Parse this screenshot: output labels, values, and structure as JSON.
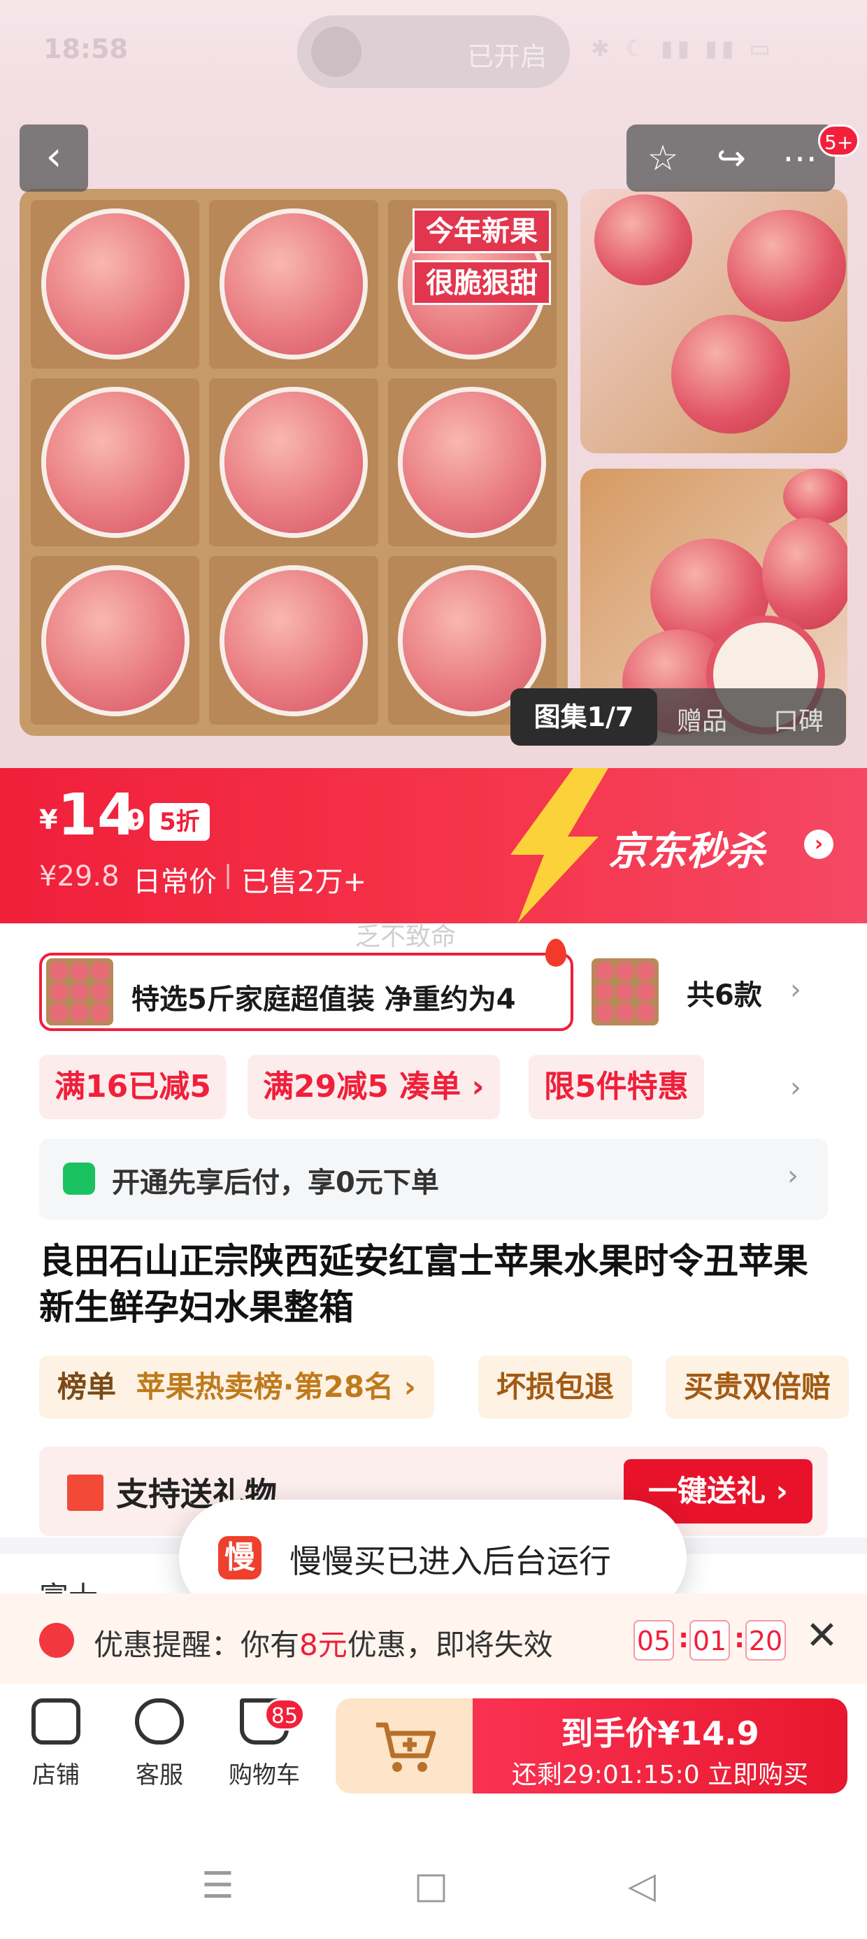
{
  "status_bar": {
    "time": "18:58",
    "voice_state": "已开启",
    "indicators": "✱ ☾ ▮▮ ▮▮ ▭"
  },
  "gallery": {
    "badge_count": "5+",
    "overlay_tags": [
      "今年新果",
      "很脆狠甜"
    ],
    "tabs": [
      {
        "label": "图集1/7",
        "active": true
      },
      {
        "label": "赠品"
      },
      {
        "label": "口碑"
      }
    ]
  },
  "price": {
    "currency": "¥",
    "integer": "14",
    "decimal": ".9",
    "discount": "5折",
    "original": "¥29.8",
    "original_label": "日常价",
    "separator": "|",
    "sold": "已售2万+",
    "promo": "京东秒杀",
    "promo_arrow": "›"
  },
  "watermark": "乏不致命",
  "variant": {
    "name": "特选5斤家庭超值装 净重约为4",
    "count": "共6款"
  },
  "coupons": [
    "满16已减5",
    "满29减5  凑单 ›",
    "限5件特惠"
  ],
  "pay_later": {
    "text": "开通先享后付，享0元下单"
  },
  "product_title": "良田石山正宗陕西延安红富士苹果水果时令丑苹果新生鲜孕妇水果整箱",
  "rank_chips": [
    {
      "label": "榜单",
      "detail": "苹果热卖榜·第28名 ›"
    },
    {
      "label": "坏损包退"
    },
    {
      "label": "买贵双倍赔"
    }
  ],
  "gift": {
    "text": "支持送礼物",
    "button": "一键送礼 ›"
  },
  "section_peek": "富士",
  "toast": {
    "icon": "慢",
    "text": "慢慢买已进入后台运行"
  },
  "reminder": {
    "prefix": "优惠提醒：你有",
    "amount": "8元",
    "suffix": "优惠，即将失效",
    "timer": [
      "05",
      "01",
      "20"
    ],
    "close": "✕"
  },
  "bottom_nav": {
    "items": [
      {
        "label": "店铺",
        "icon": "store-icon"
      },
      {
        "label": "客服",
        "icon": "service-icon"
      },
      {
        "label": "购物车",
        "icon": "cart-icon"
      }
    ],
    "cart_count": "85",
    "buy_price": "到手价¥14.9",
    "buy_sub": "还剩29:01:15:0  立即购买"
  },
  "system_nav": {
    "menu": "☰",
    "home": "□",
    "back": "◁"
  }
}
